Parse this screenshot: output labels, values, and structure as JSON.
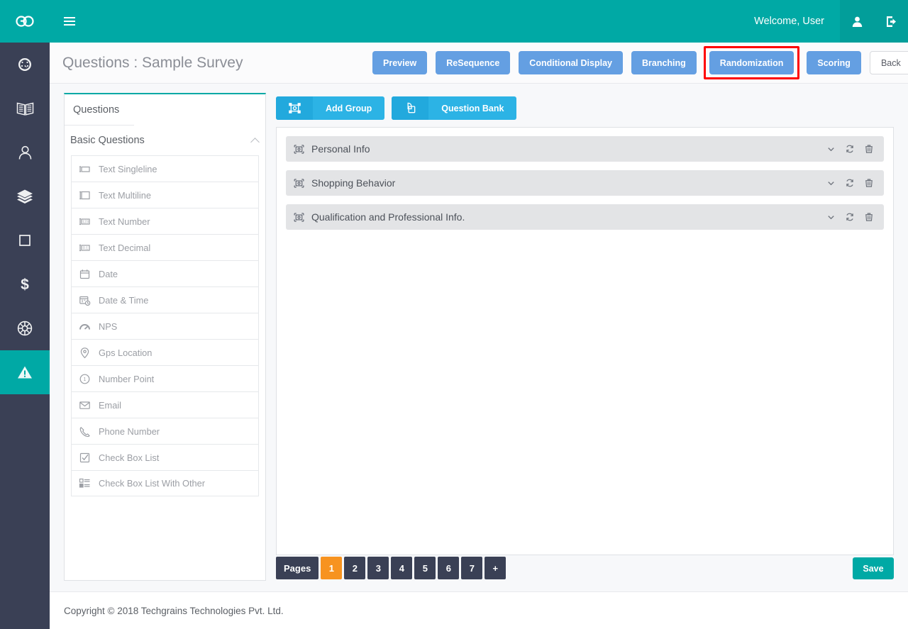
{
  "header": {
    "logo_text": "GO",
    "logo_icon": "go-logo-icon",
    "menu_icon": "hamburger-menu-icon",
    "welcome_text": "Welcome, User",
    "user_icon": "user-icon",
    "logout_icon": "logout-icon",
    "background_color": "#00a9a5"
  },
  "sidebar": {
    "background_color": "#3a4055",
    "active_color": "#00a9a5",
    "items": [
      {
        "icon": "dashboard-speedometer-icon",
        "active": false
      },
      {
        "icon": "book-icon",
        "active": false
      },
      {
        "icon": "user-icon",
        "active": false
      },
      {
        "icon": "layers-icon",
        "active": false
      },
      {
        "icon": "square-icon",
        "active": false
      },
      {
        "icon": "dollar-icon",
        "active": false
      },
      {
        "icon": "globe-icon",
        "active": false
      },
      {
        "icon": "warning-triangle-icon",
        "active": true
      }
    ]
  },
  "titlebar": {
    "title": "Questions : Sample Survey",
    "buttons": [
      {
        "label": "Preview",
        "style": "primary",
        "highlighted": false
      },
      {
        "label": "ReSequence",
        "style": "primary",
        "highlighted": false
      },
      {
        "label": "Conditional Display",
        "style": "primary",
        "highlighted": false
      },
      {
        "label": "Branching",
        "style": "primary",
        "highlighted": false
      },
      {
        "label": "Randomization",
        "style": "primary",
        "highlighted": true
      },
      {
        "label": "Scoring",
        "style": "primary",
        "highlighted": false
      },
      {
        "label": "Back",
        "style": "ghost",
        "highlighted": false
      }
    ],
    "highlight_color": "#ff0000",
    "button_color": "#649fe2"
  },
  "questions_panel": {
    "tab_label": "Questions",
    "group_label": "Basic Questions",
    "collapse_icon": "chevron-up-icon",
    "items": [
      {
        "label": "Text Singleline",
        "icon": "text-singleline-icon"
      },
      {
        "label": "Text Multiline",
        "icon": "text-multiline-icon"
      },
      {
        "label": "Text Number",
        "icon": "text-number-icon"
      },
      {
        "label": "Text Decimal",
        "icon": "text-decimal-icon"
      },
      {
        "label": "Date",
        "icon": "calendar-icon"
      },
      {
        "label": "Date & Time",
        "icon": "calendar-clock-icon"
      },
      {
        "label": "NPS",
        "icon": "gauge-icon"
      },
      {
        "label": "Gps Location",
        "icon": "map-pin-icon"
      },
      {
        "label": "Number Point",
        "icon": "number-circle-icon"
      },
      {
        "label": "Email",
        "icon": "envelope-icon"
      },
      {
        "label": "Phone Number",
        "icon": "phone-icon"
      },
      {
        "label": "Check Box List",
        "icon": "checkbox-icon"
      },
      {
        "label": "Check Box List With Other",
        "icon": "checkbox-list-icon"
      }
    ]
  },
  "main": {
    "toolbar": [
      {
        "label": "Add Group",
        "icon": "add-group-icon"
      },
      {
        "label": "Question Bank",
        "icon": "question-bank-copy-icon"
      }
    ],
    "toolbar_color": "#2cb3e5",
    "groups": [
      {
        "label": "Personal Info",
        "icon": "group-icon",
        "actions": [
          "chevron-down-icon",
          "refresh-icon",
          "trash-icon"
        ]
      },
      {
        "label": "Shopping Behavior",
        "icon": "group-icon",
        "actions": [
          "chevron-down-icon",
          "refresh-icon",
          "trash-icon"
        ]
      },
      {
        "label": "Qualification and Professional Info.",
        "icon": "group-icon",
        "actions": [
          "chevron-down-icon",
          "refresh-icon",
          "trash-icon"
        ]
      }
    ]
  },
  "pagination": {
    "label": "Pages",
    "pages": [
      "1",
      "2",
      "3",
      "4",
      "5",
      "6",
      "7"
    ],
    "active_page": "1",
    "add_label": "+",
    "active_color": "#f79320",
    "save_label": "Save",
    "save_color": "#00a9a5"
  },
  "footer": {
    "copyright": "Copyright © 2018 Techgrains Technologies Pvt. Ltd."
  }
}
